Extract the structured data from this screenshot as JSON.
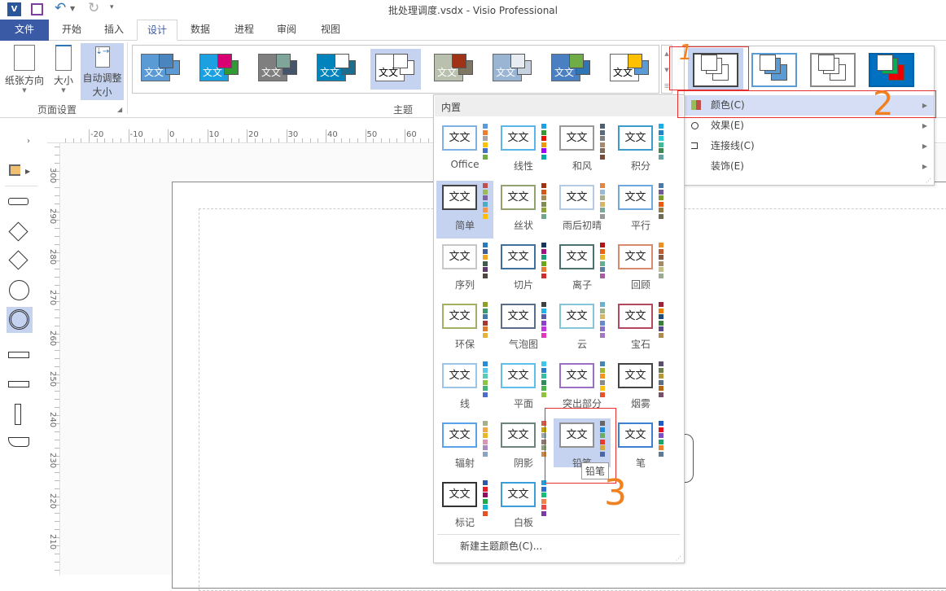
{
  "window": {
    "title": "批处理调度.vsdx - Visio Professional"
  },
  "qat": {
    "app_icon": "visio-icon",
    "save": "save-icon",
    "undo": "undo-icon",
    "redo": "redo-icon",
    "customize": "customize-icon"
  },
  "tabs": [
    {
      "label": "文件"
    },
    {
      "label": "开始"
    },
    {
      "label": "插入"
    },
    {
      "label": "设计"
    },
    {
      "label": "数据"
    },
    {
      "label": "进程"
    },
    {
      "label": "审阅"
    },
    {
      "label": "视图"
    }
  ],
  "ribbon": {
    "page_setup": {
      "orientation": "纸张方向",
      "size": "大小",
      "auto_size_1": "自动调整",
      "auto_size_2": "大小",
      "group": "页面设置"
    },
    "themes_group": "主题",
    "themes": [
      {
        "bg": "#5b9bd5",
        "c1": "#4a85c0",
        "c2": "#5b9bd5"
      },
      {
        "bg": "#1ba1e2",
        "c1": "#d80073",
        "c2": "#339933"
      },
      {
        "bg": "#7f7f7f",
        "c1": "#7fa59a",
        "c2": "#44546a"
      },
      {
        "bg": "#0084bb",
        "c1": "#ffffff",
        "c2": "#1c6d8f"
      },
      {
        "bg": "#ffffff",
        "c1": "#ffffff",
        "c2": "#ffffff"
      },
      {
        "bg": "#b9c0ad",
        "c1": "#a03315",
        "c2": "#7d7764"
      },
      {
        "bg": "#9ab5d4",
        "c1": "#e7ecf2",
        "c2": "#c7d2e0"
      },
      {
        "bg": "#4a7fc1",
        "c1": "#70ad47",
        "c2": "#2e75b6"
      },
      {
        "bg": "#ffffff",
        "c1": "#ffc000",
        "c2": "#5b9bd5"
      }
    ],
    "theme_text": "文文",
    "variants": [
      {
        "bg": "#ffffff",
        "fg": "#444"
      },
      {
        "bg": "#ffffff",
        "fg": "#5b9bd5"
      },
      {
        "bg": "#ffffff",
        "fg": "#888"
      },
      {
        "bg": "#0070c0",
        "fg": "#00b050"
      }
    ]
  },
  "variant_menu": {
    "items": [
      {
        "label": "颜色(C)",
        "icon": "color-palette-icon"
      },
      {
        "label": "效果(E)",
        "icon": "effects-icon"
      },
      {
        "label": "连接线(C)",
        "icon": "connector-icon"
      },
      {
        "label": "装饰(E)",
        "icon": ""
      }
    ]
  },
  "color_gallery": {
    "header": "内置",
    "sample": "文文",
    "items": [
      {
        "label": "Office",
        "border": "#7fb1e3",
        "colors": [
          "#5b9bd5",
          "#ed7d31",
          "#a5a5a5",
          "#ffc000",
          "#4472c4",
          "#70ad47"
        ]
      },
      {
        "label": "线性",
        "border": "#5bb5e8",
        "colors": [
          "#1ba1e2",
          "#339933",
          "#e51400",
          "#f09609",
          "#a200ff",
          "#00aba9"
        ]
      },
      {
        "label": "和风",
        "border": "#999999",
        "colors": [
          "#4f6070",
          "#5a6a7a",
          "#808080",
          "#a68a6d",
          "#7f6a5a",
          "#7a4a3a"
        ]
      },
      {
        "label": "积分",
        "border": "#3b9bcc",
        "colors": [
          "#1cade4",
          "#2683c6",
          "#27ced7",
          "#42ba97",
          "#3e8853",
          "#62a39f"
        ]
      },
      {
        "label": "简单",
        "border": "#444444",
        "colors": [
          "#c0504d",
          "#9bbb59",
          "#8064a2",
          "#4bacc6",
          "#f79646",
          "#ffc000"
        ],
        "selected": true
      },
      {
        "label": "丝状",
        "border": "#93a06f",
        "colors": [
          "#a5300f",
          "#d55816",
          "#a48c55",
          "#7f8c56",
          "#8fa23d",
          "#6fa88b"
        ]
      },
      {
        "label": "雨后初晴",
        "border": "#b5cbe3",
        "colors": [
          "#e08548",
          "#98b9d8",
          "#a9ae8b",
          "#d6b46b",
          "#7aa89b",
          "#9a9a9a"
        ]
      },
      {
        "label": "平行",
        "border": "#6fa8dc",
        "colors": [
          "#4e79a7",
          "#705b96",
          "#7a9a2d",
          "#e8580e",
          "#927b47",
          "#6d6d54"
        ]
      },
      {
        "label": "序列",
        "border": "#c8c8c8",
        "colors": [
          "#2b7bb9",
          "#3f5f95",
          "#f2a81d",
          "#3a5e4a",
          "#5e3a6e",
          "#4f4640"
        ]
      },
      {
        "label": "切片",
        "border": "#40709e",
        "colors": [
          "#17365d",
          "#a2137f",
          "#1b9e77",
          "#6ba61c",
          "#ea7a34",
          "#d12b2e"
        ]
      },
      {
        "label": "离子",
        "border": "#4c7270",
        "colors": [
          "#b01513",
          "#ea6312",
          "#e6b729",
          "#6aac90",
          "#5f7fa0",
          "#a55ea0"
        ]
      },
      {
        "label": "回顾",
        "border": "#d9896c",
        "colors": [
          "#ed8e28",
          "#bf5b33",
          "#8b5a44",
          "#a68b6a",
          "#c3c08a",
          "#9aab94"
        ]
      },
      {
        "label": "环保",
        "border": "#a2b061",
        "colors": [
          "#8e9e2b",
          "#3c9a6c",
          "#467aa6",
          "#a3392f",
          "#e07c30",
          "#e2b43c"
        ]
      },
      {
        "label": "气泡图",
        "border": "#5a6e88",
        "colors": [
          "#404040",
          "#25b0ec",
          "#5a5aa8",
          "#8941c9",
          "#c234e2",
          "#e535b8"
        ]
      },
      {
        "label": "云",
        "border": "#86c4d8",
        "colors": [
          "#6cb1d0",
          "#9bb28c",
          "#d5b968",
          "#6689c9",
          "#8a73c4",
          "#a477c0"
        ]
      },
      {
        "label": "宝石",
        "border": "#b3485e",
        "colors": [
          "#9b2335",
          "#f07c00",
          "#1f4e79",
          "#3b7d3b",
          "#5b4a8b",
          "#b08a50"
        ]
      },
      {
        "label": "线",
        "border": "#9dc5e8",
        "colors": [
          "#2a8dd4",
          "#5bc7e6",
          "#56ccb4",
          "#8ac444",
          "#46b27a",
          "#4a6ec9"
        ]
      },
      {
        "label": "平面",
        "border": "#5ec0e8",
        "colors": [
          "#3ec6ed",
          "#2b7dc7",
          "#34c0a0",
          "#2f8c5a",
          "#4ab34a",
          "#8cc43c"
        ]
      },
      {
        "label": "突出部分",
        "border": "#9b6fc4",
        "colors": [
          "#4187b8",
          "#a3b630",
          "#f7941d",
          "#8a8a8a",
          "#ffc20e",
          "#e5532a"
        ]
      },
      {
        "label": "烟雾",
        "border": "#444444",
        "colors": [
          "#5a4e6b",
          "#6e7f4e",
          "#b8973a",
          "#5a6e87",
          "#b76a12",
          "#7a4e6b"
        ]
      },
      {
        "label": "辐射",
        "border": "#59a4e8",
        "colors": [
          "#a4b08e",
          "#f4a64a",
          "#e5b824",
          "#d996b0",
          "#a78bc1",
          "#8aa4c6"
        ]
      },
      {
        "label": "阴影",
        "border": "#6e837c",
        "colors": [
          "#d45d45",
          "#c8a800",
          "#9cacb0",
          "#8e7a6e",
          "#8ea079",
          "#c98a4a"
        ]
      },
      {
        "label": "铅笔",
        "border": "#909090",
        "colors": [
          "#666666",
          "#1f8bd6",
          "#6aac6a",
          "#e83a2e",
          "#d4a83a",
          "#4a66a8"
        ],
        "hovered": true
      },
      {
        "label": "笔",
        "border": "#3e7fd4",
        "colors": [
          "#1f5ac6",
          "#e8101c",
          "#7d4fc4",
          "#1ea36b",
          "#f07f28",
          "#5d7a9a"
        ]
      },
      {
        "label": "标记",
        "border": "#333333",
        "colors": [
          "#2e5aa8",
          "#e8202a",
          "#8e1060",
          "#1eaa4a",
          "#12b8d0",
          "#e85020"
        ]
      },
      {
        "label": "白板",
        "border": "#3a9ed8",
        "colors": [
          "#1ea0e0",
          "#2e6ecf",
          "#12c07a",
          "#f07f4a",
          "#e84a4a",
          "#7a3aa8"
        ]
      }
    ],
    "tooltip": "铅笔",
    "new_colors": "新建主题颜色(C)..."
  },
  "annotations": [
    "1",
    "2",
    "3"
  ],
  "rulers": {
    "h": [
      "-20",
      "-10",
      "0",
      "10",
      "20",
      "30",
      "40",
      "50",
      "60"
    ],
    "v": [
      "300",
      "290",
      "280",
      "270",
      "260",
      "250",
      "240",
      "230",
      "220",
      "210"
    ]
  },
  "shapes": [
    "rectangle",
    "diamond",
    "diamond",
    "circle",
    "circle",
    "rectangle",
    "rectangle",
    "tall-rectangle",
    "document"
  ]
}
